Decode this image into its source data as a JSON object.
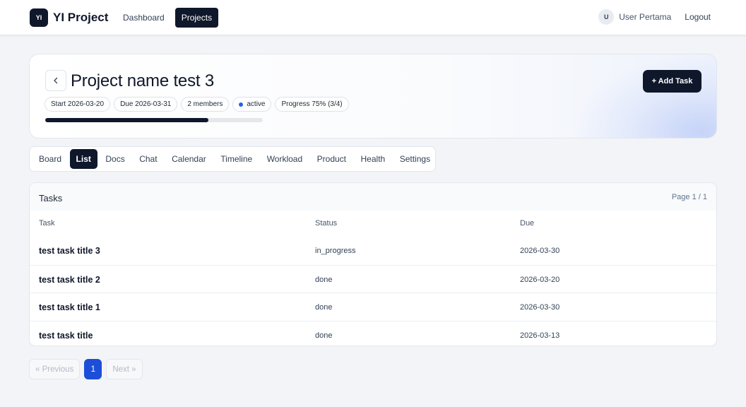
{
  "navbar": {
    "logo_text": "YI",
    "brand": "YI Project",
    "links": [
      {
        "label": "Dashboard",
        "active": false
      },
      {
        "label": "Projects",
        "active": true
      }
    ],
    "avatar_initial": "U",
    "user_name": "User Pertama",
    "logout_label": "Logout"
  },
  "project": {
    "back_icon": "chevron-left-icon",
    "title": "Project name test 3",
    "chips": {
      "start": "Start 2026-03-20",
      "due": "Due 2026-03-31",
      "members": "2 members",
      "status": "active",
      "progress": "Progress 75% (3/4)"
    },
    "progress_fraction": 0.75,
    "status_dot_color": "#2563eb",
    "add_task_label": "+ Add Task"
  },
  "tabs": [
    {
      "label": "Board",
      "active": false
    },
    {
      "label": "List",
      "active": true
    },
    {
      "label": "Docs",
      "active": false
    },
    {
      "label": "Chat",
      "active": false
    },
    {
      "label": "Calendar",
      "active": false
    },
    {
      "label": "Timeline",
      "active": false
    },
    {
      "label": "Workload",
      "active": false
    },
    {
      "label": "Product",
      "active": false
    },
    {
      "label": "Health",
      "active": false
    },
    {
      "label": "Settings",
      "active": false
    }
  ],
  "tasks": {
    "title": "Tasks",
    "page_info": "Page 1 / 1",
    "columns": {
      "task": "Task",
      "status": "Status",
      "due": "Due"
    },
    "rows": [
      {
        "task": "test task title 3",
        "status": "in_progress",
        "due": "2026-03-30"
      },
      {
        "task": "test task title 2",
        "status": "done",
        "due": "2026-03-20"
      },
      {
        "task": "test task title 1",
        "status": "done",
        "due": "2026-03-30"
      },
      {
        "task": "test task title",
        "status": "done",
        "due": "2026-03-13"
      }
    ]
  },
  "pagination": {
    "previous": "« Previous",
    "current": "1",
    "next": "Next »"
  },
  "colors": {
    "primary_dark": "#0f172a",
    "accent_blue": "#1d4ed8"
  }
}
